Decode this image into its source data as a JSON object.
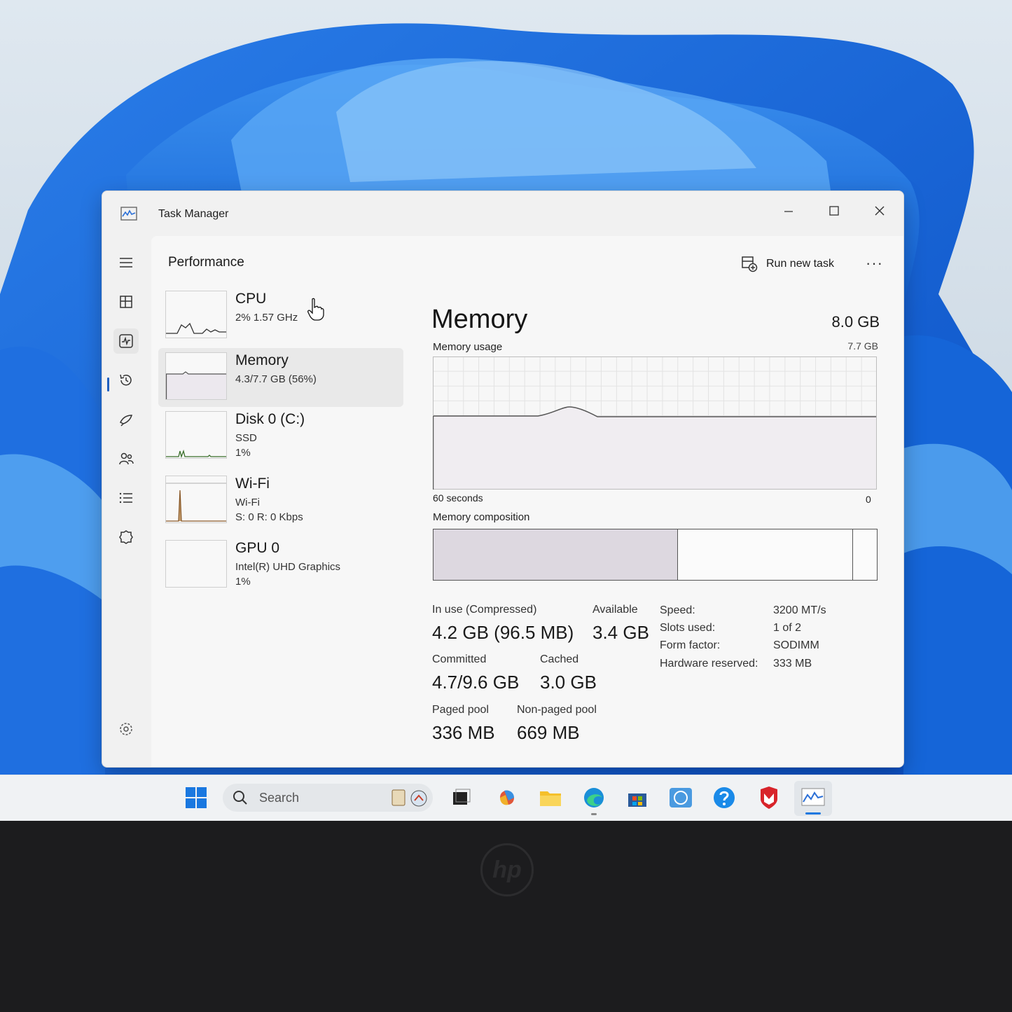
{
  "window": {
    "title": "Task Manager",
    "minimize": "—",
    "maximize": "☐",
    "close": "✕"
  },
  "header": {
    "title": "Performance",
    "run_new_task": "Run new task",
    "more": "···"
  },
  "nav": {
    "items": [
      {
        "name": "hamburger-menu-icon"
      },
      {
        "name": "processes-icon"
      },
      {
        "name": "performance-icon"
      },
      {
        "name": "app-history-icon"
      },
      {
        "name": "startup-apps-icon"
      },
      {
        "name": "users-icon"
      },
      {
        "name": "details-icon"
      },
      {
        "name": "services-icon"
      }
    ],
    "active_index": 2
  },
  "devices": [
    {
      "name": "CPU",
      "line1": "2% 1.57 GHz",
      "line2": ""
    },
    {
      "name": "Memory",
      "line1": "4.3/7.7 GB (56%)",
      "line2": ""
    },
    {
      "name": "Disk 0 (C:)",
      "line1": "SSD",
      "line2": "1%"
    },
    {
      "name": "Wi-Fi",
      "line1": "Wi-Fi",
      "line2": "S: 0 R: 0 Kbps"
    },
    {
      "name": "GPU 0",
      "line1": "Intel(R) UHD Graphics",
      "line2": "1%"
    }
  ],
  "memory": {
    "title": "Memory",
    "total": "8.0 GB",
    "usage_label": "Memory usage",
    "usage_max": "7.7 GB",
    "axis_left": "60 seconds",
    "axis_right": "0",
    "composition_label": "Memory composition",
    "composition": {
      "in_use_fraction": 0.55,
      "standby_fraction": 0.395
    },
    "stats": {
      "in_use_label": "In use (Compressed)",
      "in_use_value": "4.2 GB (96.5 MB)",
      "available_label": "Available",
      "available_value": "3.4 GB",
      "committed_label": "Committed",
      "committed_value": "4.7/9.6 GB",
      "cached_label": "Cached",
      "cached_value": "3.0 GB",
      "paged_label": "Paged pool",
      "paged_value": "336 MB",
      "nonpaged_label": "Non-paged pool",
      "nonpaged_value": "669 MB"
    },
    "specs": {
      "speed_label": "Speed:",
      "speed_value": "3200 MT/s",
      "slots_label": "Slots used:",
      "slots_value": "1 of 2",
      "form_label": "Form factor:",
      "form_value": "SODIMM",
      "reserved_label": "Hardware reserved:",
      "reserved_value": "333 MB"
    }
  },
  "taskbar": {
    "search_placeholder": "Search"
  },
  "colors": {
    "accent": "#1f5fbf",
    "composition_in_use": "#ddd8e0",
    "graph_line": "#555555"
  }
}
